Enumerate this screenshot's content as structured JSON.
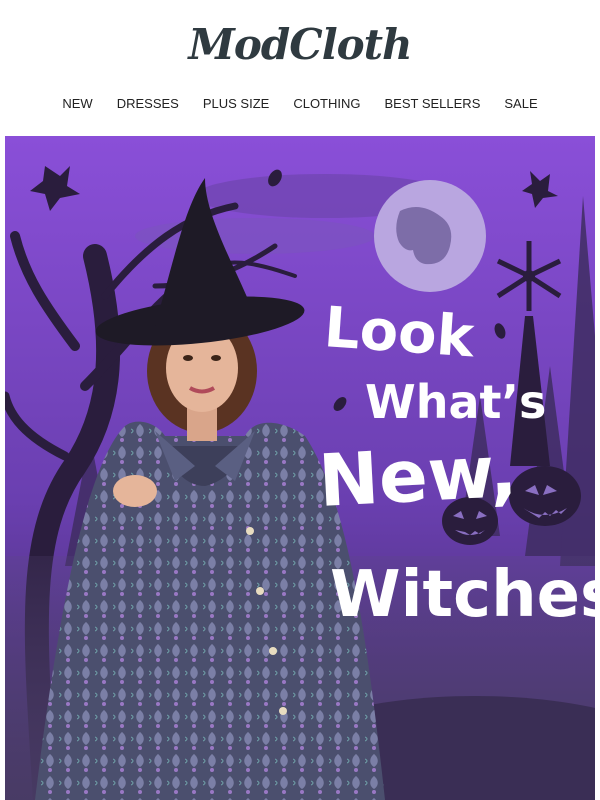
{
  "brand": {
    "logo": "ModCloth"
  },
  "nav": [
    {
      "label": "NEW"
    },
    {
      "label": "DRESSES"
    },
    {
      "label": "PLUS SIZE"
    },
    {
      "label": "CLOTHING"
    },
    {
      "label": "BEST SELLERS"
    },
    {
      "label": "SALE"
    }
  ],
  "hero": {
    "line1": "Look",
    "line2": "What’s",
    "line3": "New,",
    "line4": "Witches!",
    "colors": {
      "sky_top": "#8a4fd8",
      "sky_bottom": "#3b2a5c",
      "moon": "#b9a6e0",
      "silhouette": "#2a1d3d",
      "headline": "#ffffff"
    }
  }
}
